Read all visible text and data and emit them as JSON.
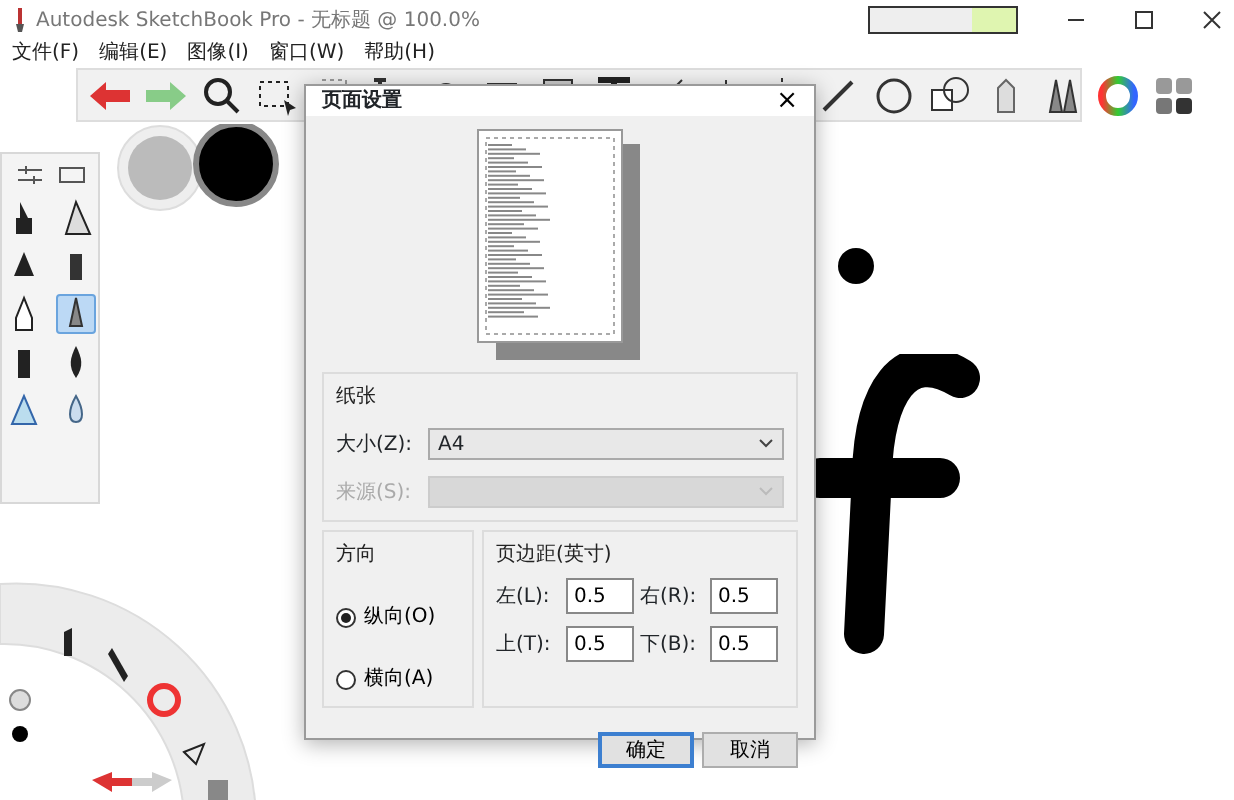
{
  "window": {
    "title": "Autodesk SketchBook Pro - 无标题 @ 100.0%"
  },
  "menu": [
    {
      "label": "文件(F)"
    },
    {
      "label": "编辑(E)"
    },
    {
      "label": "图像(I)"
    },
    {
      "label": "窗口(W)"
    },
    {
      "label": "帮助(H)"
    }
  ],
  "brush_palette": {
    "brushes": [
      {
        "selected": false
      },
      {
        "selected": false
      },
      {
        "selected": false
      },
      {
        "selected": false
      },
      {
        "selected": false
      },
      {
        "selected": true
      },
      {
        "selected": false
      },
      {
        "selected": false
      },
      {
        "selected": false
      },
      {
        "selected": false
      }
    ]
  },
  "dialog": {
    "title": "页面设置",
    "close": "×",
    "paper": {
      "legend": "纸张",
      "size_label": "大小(Z):",
      "size_value": "A4",
      "source_label": "来源(S):",
      "source_disabled": true
    },
    "orientation": {
      "legend": "方向",
      "options": [
        {
          "label": "纵向(O)",
          "selected": true
        },
        {
          "label": "横向(A)",
          "selected": false
        }
      ]
    },
    "margins": {
      "legend": "页边距(英寸)",
      "fields": [
        {
          "label": "左(L):",
          "value": "0.5"
        },
        {
          "label": "右(R):",
          "value": "0.5"
        },
        {
          "label": "上(T):",
          "value": "0.5"
        },
        {
          "label": "下(B):",
          "value": "0.5"
        }
      ]
    },
    "buttons": [
      {
        "label": "确定",
        "default": true
      },
      {
        "label": "取消",
        "default": false
      }
    ]
  }
}
